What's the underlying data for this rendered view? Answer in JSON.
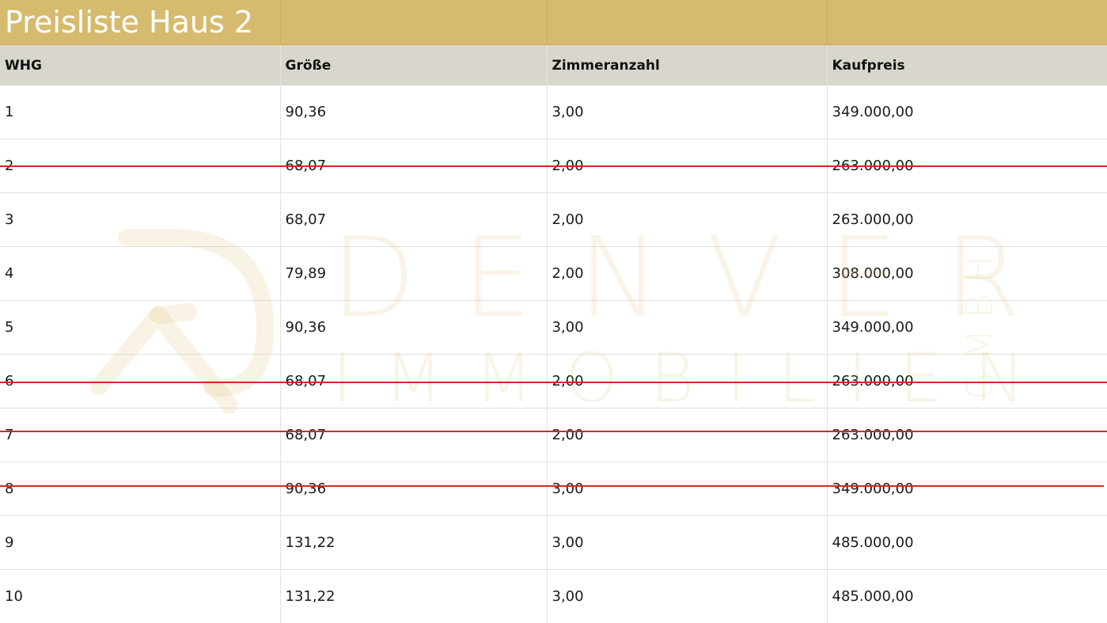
{
  "title": "Preisliste Haus 2",
  "columns": [
    "WHG",
    "Größe",
    "Zimmeranzahl",
    "Kaufpreis"
  ],
  "rows": [
    {
      "whg": "1",
      "groesse": "90,36",
      "zimmer": "3,00",
      "kaufpreis": "349.000,00",
      "crossed_out": false
    },
    {
      "whg": "2",
      "groesse": "68,07",
      "zimmer": "2,00",
      "kaufpreis": "263.000,00",
      "crossed_out": true
    },
    {
      "whg": "3",
      "groesse": "68,07",
      "zimmer": "2,00",
      "kaufpreis": "263.000,00",
      "crossed_out": false
    },
    {
      "whg": "4",
      "groesse": "79,89",
      "zimmer": "2,00",
      "kaufpreis": "308.000,00",
      "crossed_out": false
    },
    {
      "whg": "5",
      "groesse": "90,36",
      "zimmer": "3,00",
      "kaufpreis": "349.000,00",
      "crossed_out": false
    },
    {
      "whg": "6",
      "groesse": "68,07",
      "zimmer": "2,00",
      "kaufpreis": "263.000,00",
      "crossed_out": true
    },
    {
      "whg": "7",
      "groesse": "68,07",
      "zimmer": "2,00",
      "kaufpreis": "263.000,00",
      "crossed_out": true
    },
    {
      "whg": "8",
      "groesse": "90,36",
      "zimmer": "3,00",
      "kaufpreis": "349.000,00",
      "crossed_out": true
    },
    {
      "whg": "9",
      "groesse": "131,22",
      "zimmer": "3,00",
      "kaufpreis": "485.000,00",
      "crossed_out": false
    },
    {
      "whg": "10",
      "groesse": "131,22",
      "zimmer": "3,00",
      "kaufpreis": "485.000,00",
      "crossed_out": false
    }
  ],
  "watermark": {
    "line1": "DENVER",
    "line2": "IMMOBILIEN",
    "suffix": "GMBH"
  },
  "colors": {
    "title_bg": "#d6bb6f",
    "header_bg": "#d8d6cd",
    "strike": "#d62828",
    "watermark": "#dcc378"
  }
}
